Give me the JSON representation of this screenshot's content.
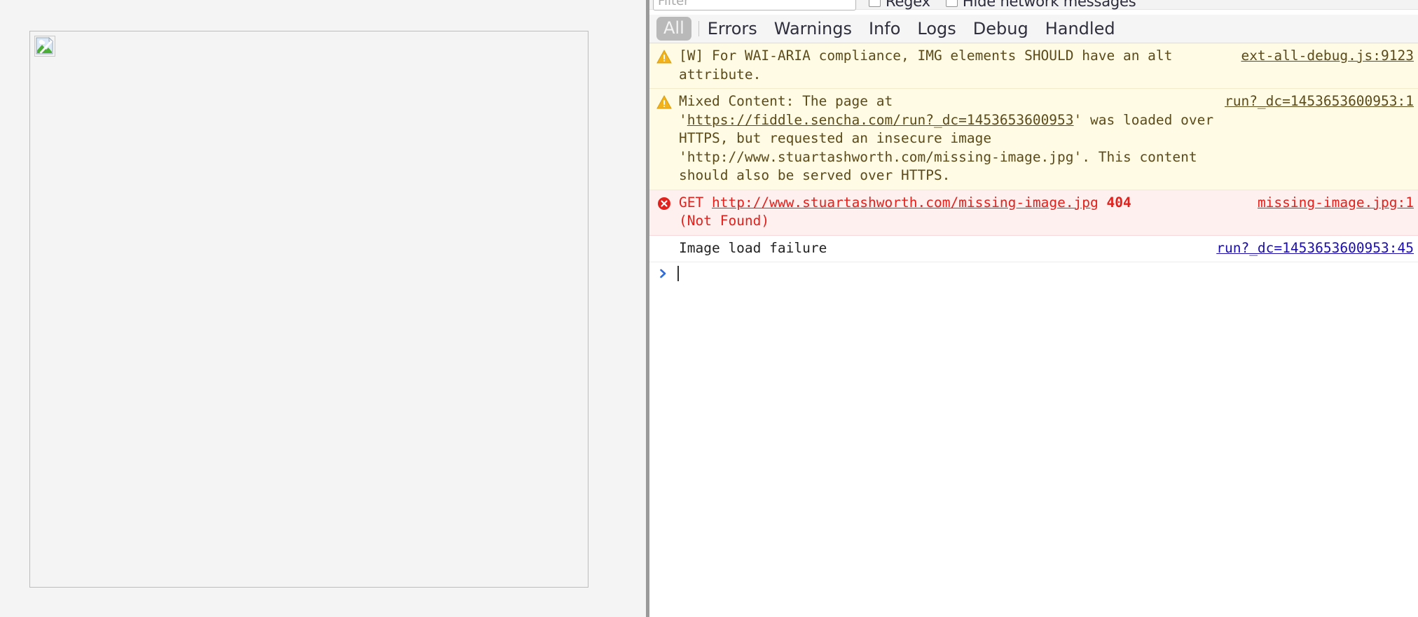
{
  "left_pane": {
    "broken_image_alt": "broken-image-placeholder"
  },
  "console": {
    "filter": {
      "placeholder": "Filter",
      "value": ""
    },
    "options": [
      {
        "label": "Regex",
        "checked": false
      },
      {
        "label": "Hide network messages",
        "checked": false
      }
    ],
    "levels": {
      "selected": "All",
      "items": [
        "Errors",
        "Warnings",
        "Info",
        "Logs",
        "Debug",
        "Handled"
      ]
    },
    "messages": [
      {
        "kind": "warning",
        "icon": "warning-triangle-icon",
        "text": "[W] For WAI-ARIA compliance, IMG elements SHOULD have an alt attribute.",
        "source": "ext-all-debug.js:9123"
      },
      {
        "kind": "warning",
        "icon": "warning-triangle-icon",
        "text_before_link": "Mixed Content: The page at\n'",
        "link": "https://fiddle.sencha.com/run?_dc=1453653600953",
        "text_after_link": "' was loaded over HTTPS, but requested an insecure image 'http://www.stuartashworth.com/missing-image.jpg'. This content should also be served over HTTPS.",
        "source": "run?_dc=1453653600953:1"
      },
      {
        "kind": "error",
        "icon": "error-circle-icon",
        "method": "GET",
        "link": "http://www.stuartashworth.com/missing-image.jpg",
        "status_code": "404",
        "status_text": "(Not Found)",
        "source": "missing-image.jpg:1"
      },
      {
        "kind": "plain",
        "icon": "",
        "text": "Image load failure",
        "source": "run?_dc=1453653600953:45"
      }
    ],
    "prompt": {
      "chevron": "chevron-right-icon",
      "value": ""
    }
  },
  "colors": {
    "warning_bg": "#fffbe5",
    "warning_text": "#5c4b1a",
    "error_bg": "#fff0f0",
    "error_text": "#e2211c",
    "link": "#1a0dab",
    "prompt_chevron": "#2d6cdf",
    "chrome_bg": "#f4f4f4"
  }
}
